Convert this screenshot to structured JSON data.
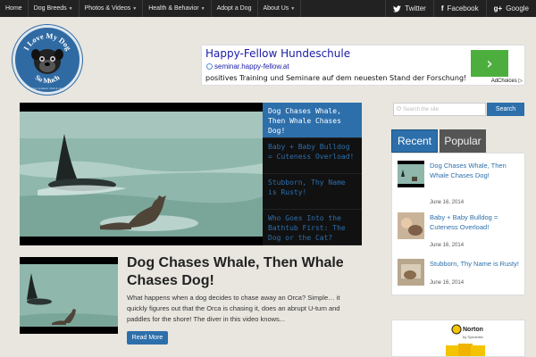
{
  "nav": {
    "items": [
      {
        "label": "Home",
        "caret": false
      },
      {
        "label": "Dog Breeds",
        "caret": true
      },
      {
        "label": "Photos & Videos",
        "caret": true
      },
      {
        "label": "Health & Behavior",
        "caret": true
      },
      {
        "label": "Adopt a Dog",
        "caret": false
      },
      {
        "label": "About Us",
        "caret": true
      }
    ],
    "social": [
      {
        "label": "Twitter",
        "icon": "twitter-bird-icon"
      },
      {
        "label": "Facebook",
        "icon": "facebook-f-icon"
      },
      {
        "label": "Google",
        "icon": "google-g-icon"
      }
    ]
  },
  "logo": {
    "top": "I Love My Dog",
    "bottom": "So Much",
    "tagline": "Stay Updated. Click & Like"
  },
  "ad": {
    "title": "Happy-Fellow Hundeschule",
    "url": "seminar.happy-fellow.at",
    "description": "positives Training und Seminare auf dem neuesten Stand der Forschung!",
    "arrow": "›",
    "choices": "AdChoices ▷",
    "brand_color": "#4caf3d"
  },
  "slider": {
    "items": [
      "Dog Chases Whale, Then Whale Chases Dog!",
      "Baby + Baby Bulldog = Cuteness Overload!",
      "Stubborn, Thy Name is Rusty!",
      "Who Goes Into the Bathtub First: The Dog or the Cat?"
    ],
    "active_index": 0
  },
  "post": {
    "title": "Dog Chases Whale, Then Whale Chases Dog!",
    "excerpt": "What happens when a dog decides to chase away an Orca? Simple… it quickly figures out that the Orca is chasing it, does an abrupt U-turn and paddles for the shore! The diver in this video knows...",
    "read_more": "Read More"
  },
  "sidebar": {
    "search_placeholder": "Search the site",
    "search_button": "Search",
    "tabs": [
      "Recent",
      "Popular"
    ],
    "recent": [
      {
        "title": "Dog Chases Whale, Then Whale Chases Dog!",
        "date": "June 16, 2014"
      },
      {
        "title": "Baby + Baby Bulldog = Cuteness Overload!",
        "date": "June 16, 2014"
      },
      {
        "title": "Stubborn, Thy Name is Rusty!",
        "date": "June 16, 2014"
      }
    ],
    "norton": {
      "brand": "Norton",
      "sub": "by Symantec"
    }
  },
  "colors": {
    "accent": "#2d6fab",
    "nav_bg": "#222222",
    "page_bg": "#e8e6df"
  }
}
